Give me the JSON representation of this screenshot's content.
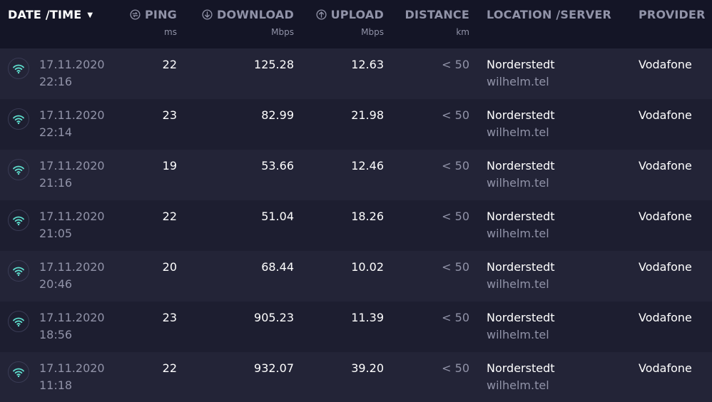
{
  "header": {
    "date_time": "DATE /TIME",
    "ping": "PING",
    "ping_unit": "ms",
    "download": "DOWNLOAD",
    "download_unit": "Mbps",
    "upload": "UPLOAD",
    "upload_unit": "Mbps",
    "distance": "DISTANCE",
    "distance_unit": "km",
    "location": "LOCATION /SERVER",
    "provider": "PROVIDER"
  },
  "icons": {
    "row_icon": "wifi-icon",
    "ping_icon": "ping-icon",
    "download_icon": "download-icon",
    "upload_icon": "upload-icon",
    "sort_icon": "caret-down-icon"
  },
  "colors": {
    "accent": "#5fe0cf",
    "background": "#141526",
    "row_odd": "#232437",
    "row_even": "#1d1e30",
    "muted_text": "#9193a8"
  },
  "rows": [
    {
      "date": "17.11.2020",
      "time": "22:16",
      "ping": "22",
      "download": "125.28",
      "upload": "12.63",
      "distance": "< 50",
      "location": "Norderstedt",
      "server": "wilhelm.tel",
      "provider": "Vodafone"
    },
    {
      "date": "17.11.2020",
      "time": "22:14",
      "ping": "23",
      "download": "82.99",
      "upload": "21.98",
      "distance": "< 50",
      "location": "Norderstedt",
      "server": "wilhelm.tel",
      "provider": "Vodafone"
    },
    {
      "date": "17.11.2020",
      "time": "21:16",
      "ping": "19",
      "download": "53.66",
      "upload": "12.46",
      "distance": "< 50",
      "location": "Norderstedt",
      "server": "wilhelm.tel",
      "provider": "Vodafone"
    },
    {
      "date": "17.11.2020",
      "time": "21:05",
      "ping": "22",
      "download": "51.04",
      "upload": "18.26",
      "distance": "< 50",
      "location": "Norderstedt",
      "server": "wilhelm.tel",
      "provider": "Vodafone"
    },
    {
      "date": "17.11.2020",
      "time": "20:46",
      "ping": "20",
      "download": "68.44",
      "upload": "10.02",
      "distance": "< 50",
      "location": "Norderstedt",
      "server": "wilhelm.tel",
      "provider": "Vodafone"
    },
    {
      "date": "17.11.2020",
      "time": "18:56",
      "ping": "23",
      "download": "905.23",
      "upload": "11.39",
      "distance": "< 50",
      "location": "Norderstedt",
      "server": "wilhelm.tel",
      "provider": "Vodafone"
    },
    {
      "date": "17.11.2020",
      "time": "11:18",
      "ping": "22",
      "download": "932.07",
      "upload": "39.20",
      "distance": "< 50",
      "location": "Norderstedt",
      "server": "wilhelm.tel",
      "provider": "Vodafone"
    }
  ]
}
